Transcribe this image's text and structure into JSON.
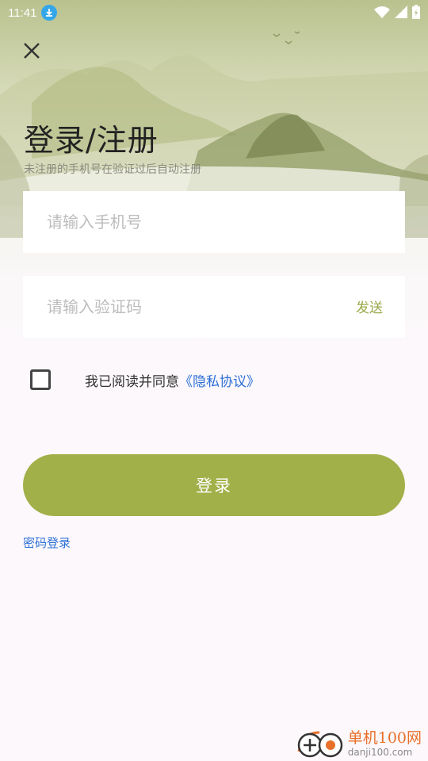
{
  "status": {
    "time": "11:41",
    "download_icon": "download-icon",
    "wifi_icon": "wifi-icon",
    "signal_icon": "signal-icon",
    "battery_icon": "battery-charging-icon"
  },
  "header": {
    "close_icon": "close-icon",
    "title": "登录/注册",
    "subtitle": "未注册的手机号在验证过后自动注册"
  },
  "form": {
    "phone_placeholder": "请输入手机号",
    "phone_value": "",
    "code_placeholder": "请输入验证码",
    "code_value": "",
    "send_label": "发送",
    "agree_text": "我已阅读并同意",
    "privacy_link": "《隐私协议》",
    "agree_checked": false,
    "login_label": "登录",
    "password_login_label": "密码登录"
  },
  "colors": {
    "accent": "#a1b048",
    "link": "#2d6fd6",
    "send": "#9aa84a"
  },
  "watermark": {
    "name": "单机100网",
    "url": "danji100.com"
  }
}
